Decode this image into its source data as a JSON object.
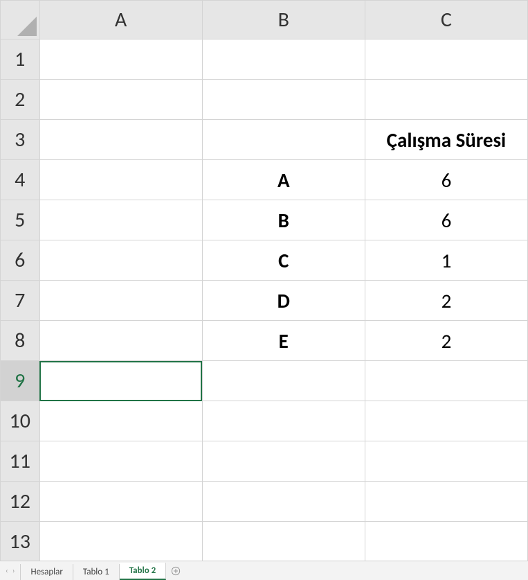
{
  "columns": [
    "A",
    "B",
    "C"
  ],
  "rows": [
    "1",
    "2",
    "3",
    "4",
    "5",
    "6",
    "7",
    "8",
    "9",
    "10",
    "11",
    "12",
    "13"
  ],
  "selected_row_index": 8,
  "selected_cell": {
    "row": 9,
    "col": "A"
  },
  "cells": {
    "C3": {
      "value": "Çalışma Süresi",
      "bold": true
    },
    "B4": {
      "value": "A",
      "bold": true
    },
    "C4": {
      "value": "6",
      "bold": false
    },
    "B5": {
      "value": "B",
      "bold": true
    },
    "C5": {
      "value": "6",
      "bold": false
    },
    "B6": {
      "value": "C",
      "bold": true
    },
    "C6": {
      "value": "1",
      "bold": false
    },
    "B7": {
      "value": "D",
      "bold": true
    },
    "C7": {
      "value": "2",
      "bold": false
    },
    "B8": {
      "value": "E",
      "bold": true
    },
    "C8": {
      "value": "2",
      "bold": false
    }
  },
  "tabs": [
    {
      "label": "Hesaplar",
      "active": false
    },
    {
      "label": "Tablo 1",
      "active": false
    },
    {
      "label": "Tablo 2",
      "active": true
    }
  ],
  "nav": {
    "prev": "‹",
    "next": "›"
  }
}
